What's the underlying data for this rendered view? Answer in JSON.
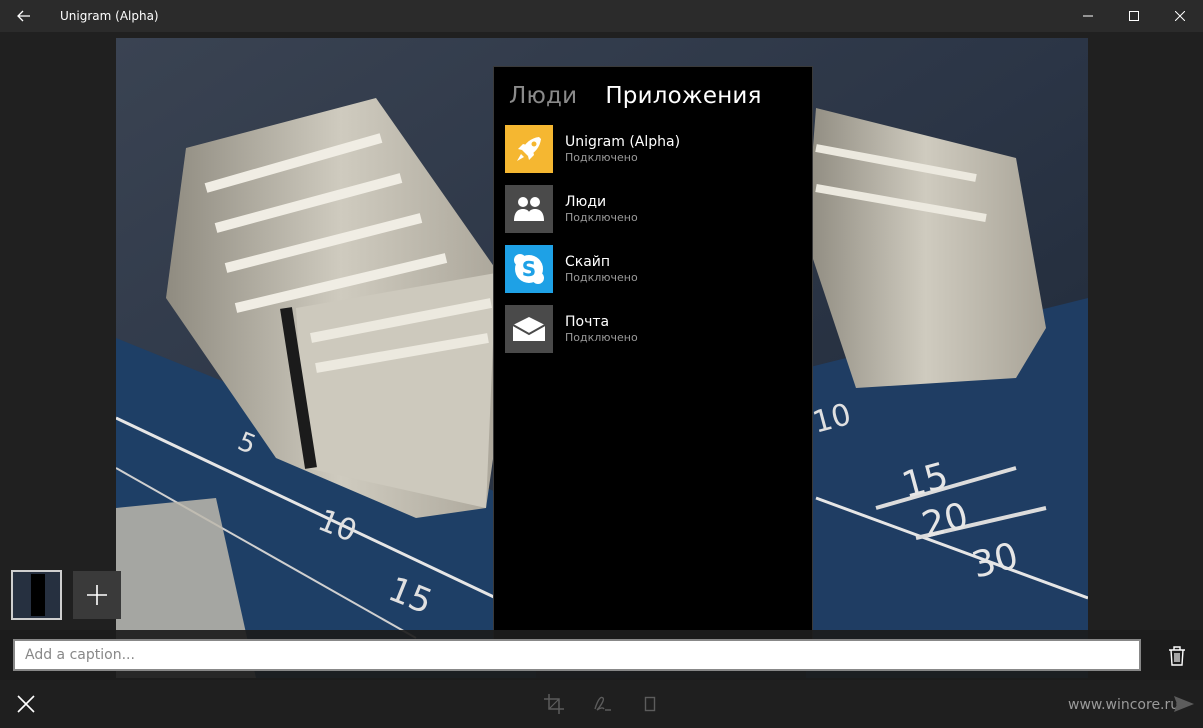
{
  "window": {
    "title": "Unigram (Alpha)"
  },
  "share": {
    "tabs": [
      {
        "label": "Люди",
        "active": false
      },
      {
        "label": "Приложения",
        "active": true
      }
    ],
    "apps": [
      {
        "name": "Unigram (Alpha)",
        "status": "Подключено",
        "icon": "rocket-icon",
        "color": "#f5b731"
      },
      {
        "name": "Люди",
        "status": "Подключено",
        "icon": "people-icon",
        "color": "#4a4a4a"
      },
      {
        "name": "Скайп",
        "status": "Подключено",
        "icon": "skype-icon",
        "color": "#1ea1e6"
      },
      {
        "name": "Почта",
        "status": "Подключено",
        "icon": "mail-icon",
        "color": "#4a4a4a"
      }
    ]
  },
  "caption": {
    "placeholder": "Add a caption..."
  },
  "watermark": "www.wincore.ru"
}
